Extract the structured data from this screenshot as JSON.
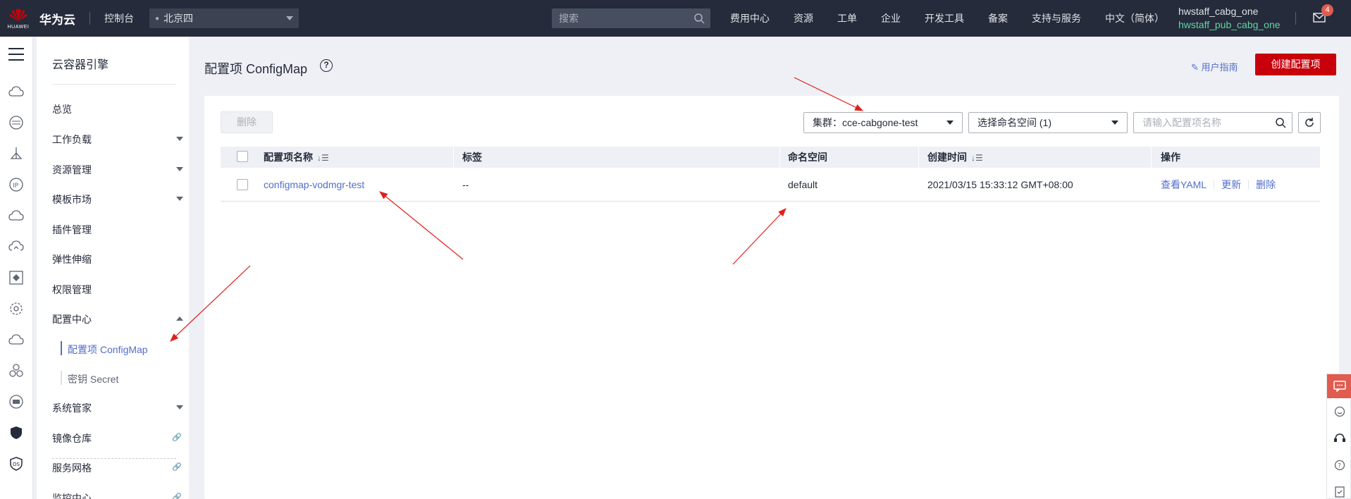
{
  "topbar": {
    "logo_text": "HUAWEI",
    "brand": "华为云",
    "console": "控制台",
    "region": "北京四",
    "search_placeholder": "搜索",
    "nav": [
      "费用中心",
      "资源",
      "工单",
      "企业",
      "开发工具",
      "备案",
      "支持与服务",
      "中文（简体）"
    ],
    "user_name": "hwstaff_cabg_one",
    "account_name": "hwstaff_pub_cabg_one",
    "notification_count": "4"
  },
  "sidebar": {
    "title": "云容器引擎",
    "items": [
      {
        "label": "总览",
        "arrow": "none"
      },
      {
        "label": "工作负载",
        "arrow": "down"
      },
      {
        "label": "资源管理",
        "arrow": "down"
      },
      {
        "label": "模板市场",
        "arrow": "down"
      },
      {
        "label": "插件管理",
        "arrow": "none"
      },
      {
        "label": "弹性伸缩",
        "arrow": "none"
      },
      {
        "label": "权限管理",
        "arrow": "none"
      },
      {
        "label": "配置中心",
        "arrow": "up"
      }
    ],
    "sub_items": [
      {
        "label": "配置项 ConfigMap",
        "active": true
      },
      {
        "label": "密钥 Secret",
        "active": false
      }
    ],
    "items_after": [
      {
        "label": "系统管家",
        "arrow": "down"
      },
      {
        "label": "镜像仓库",
        "arrow": "link"
      },
      {
        "label": "服务网格",
        "arrow": "link"
      },
      {
        "label": "监控中心",
        "arrow": "link"
      }
    ]
  },
  "page": {
    "title": "配置项 ConfigMap",
    "guide": "用户指南",
    "create_button": "创建配置项"
  },
  "toolbar": {
    "delete_button": "删除",
    "cluster_select": "集群：cce-cabgone-test",
    "namespace_select": "选择命名空间 (1)",
    "search_placeholder": "请输入配置项名称"
  },
  "table": {
    "columns": [
      "配置项名称",
      "标签",
      "命名空间",
      "创建时间",
      "操作"
    ],
    "rows": [
      {
        "name": "configmap-vodmgr-test",
        "labels": "--",
        "namespace": "default",
        "created": "2021/03/15 15:33:12 GMT+08:00",
        "actions": [
          "查看YAML",
          "更新",
          "删除"
        ]
      }
    ]
  },
  "colors": {
    "topbar_bg": "#252b3a",
    "accent": "#526ecc",
    "primary_button": "#c7000b",
    "annotation_arrow": "#e0201e"
  },
  "icons": {
    "rail": [
      "menu-icon",
      "cloud-icon",
      "database-icon",
      "anchor-icon",
      "ip-icon",
      "cloud-icon",
      "cloud-upload-icon",
      "diamond-icon",
      "gear-icon",
      "cloud-icon",
      "cluster-icon",
      "monitor-icon",
      "shield-icon",
      "terminal-icon"
    ],
    "float": [
      "chat-icon",
      "smile-icon",
      "headset-icon",
      "help-icon",
      "checklist-icon"
    ]
  }
}
